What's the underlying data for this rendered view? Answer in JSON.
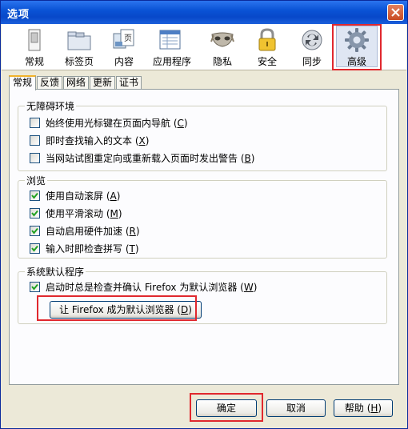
{
  "window": {
    "title": "选项"
  },
  "toolbar": {
    "items": [
      {
        "label": "常规",
        "icon": "general-icon"
      },
      {
        "label": "标签页",
        "icon": "tabs-icon"
      },
      {
        "label": "内容",
        "icon": "content-icon"
      },
      {
        "label": "应用程序",
        "icon": "applications-icon"
      },
      {
        "label": "隐私",
        "icon": "privacy-mask-icon"
      },
      {
        "label": "安全",
        "icon": "lock-icon"
      },
      {
        "label": "同步",
        "icon": "sync-icon"
      },
      {
        "label": "高级",
        "icon": "gear-icon",
        "selected": true
      }
    ]
  },
  "tabs": [
    "常规",
    "反馈",
    "网络",
    "更新",
    "证书"
  ],
  "accessibility": {
    "title": "无障碍环境",
    "options": [
      {
        "label": "始终使用光标键在页面内导航 (",
        "key": "C",
        "end": ")",
        "checked": false
      },
      {
        "label": "即时查找输入的文本 (",
        "key": "X",
        "end": ")",
        "checked": false
      },
      {
        "label": "当网站试图重定向或重新载入页面时发出警告 (",
        "key": "B",
        "end": ")",
        "checked": false
      }
    ]
  },
  "browsing": {
    "title": "浏览",
    "options": [
      {
        "label": "使用自动滚屏 (",
        "key": "A",
        "end": ")",
        "checked": true
      },
      {
        "label": "使用平滑滚动 (",
        "key": "M",
        "end": ")",
        "checked": true
      },
      {
        "label": "自动启用硬件加速 (",
        "key": "R",
        "end": ")",
        "checked": true
      },
      {
        "label": "输入时即检查拼写 (",
        "key": "T",
        "end": ")",
        "checked": true
      }
    ]
  },
  "system_defaults": {
    "title": "系统默认程序",
    "option": {
      "label": "启动时总是检查并确认 Firefox 为默认浏览器 (",
      "key": "W",
      "end": ")",
      "checked": true
    },
    "button": {
      "label": "让 Firefox 成为默认浏览器 (",
      "key": "D",
      "end": ")"
    }
  },
  "buttons": {
    "ok": "确定",
    "cancel": "取消",
    "help": "帮助 (",
    "help_key": "H",
    "help_end": ")"
  },
  "colors": {
    "highlight": "#e0282e",
    "title_bar": "#0a53d6",
    "active_tab_accent": "#f1b22b"
  }
}
